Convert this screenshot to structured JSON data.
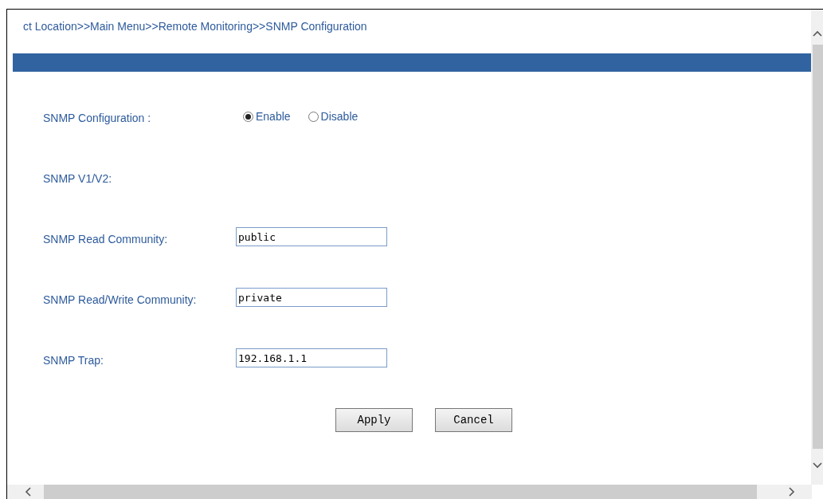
{
  "breadcrumb": "ct Location>>Main Menu>>Remote Monitoring>>SNMP Configuration",
  "fields": [
    {
      "kind": "radio",
      "label": "SNMP Configuration :",
      "options": [
        {
          "label": "Enable",
          "selected": true
        },
        {
          "label": "Disable",
          "selected": false
        }
      ]
    },
    {
      "kind": "heading",
      "label": "SNMP V1/V2:"
    },
    {
      "kind": "text",
      "label": "SNMP Read Community:",
      "value": "public"
    },
    {
      "kind": "text",
      "label": "SNMP Read/Write Community:",
      "value": "private"
    },
    {
      "kind": "text",
      "label": "SNMP Trap:",
      "value": "192.168.1.1"
    }
  ],
  "buttons": [
    "Apply",
    "Cancel"
  ]
}
